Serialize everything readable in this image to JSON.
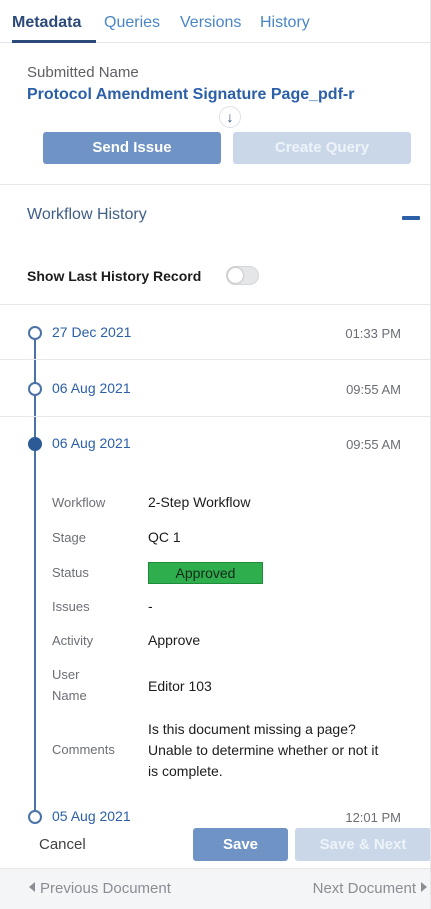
{
  "tabs": [
    "Metadata",
    "Queries",
    "Versions",
    "History"
  ],
  "submitted": {
    "label": "Submitted Name",
    "value": "Protocol Amendment Signature Page_pdf-r"
  },
  "actions": {
    "send_issue": "Send Issue",
    "create_query": "Create Query"
  },
  "workflow": {
    "title": "Workflow History",
    "toggle_label": "Show Last History Record",
    "toggle_on": false
  },
  "history": [
    {
      "date": "27 Dec 2021",
      "time": "01:33 PM"
    },
    {
      "date": "06 Aug 2021",
      "time": "09:55 AM"
    },
    {
      "date": "06 Aug 2021",
      "time": "09:55 AM"
    },
    {
      "date": "05 Aug 2021",
      "time": "12:01 PM"
    }
  ],
  "details": {
    "workflow_label": "Workflow",
    "workflow_value": "2-Step Workflow",
    "stage_label": "Stage",
    "stage_value": "QC 1",
    "status_label": "Status",
    "status_value": "Approved",
    "issues_label": "Issues",
    "issues_value": "-",
    "activity_label": "Activity",
    "activity_value": "Approve",
    "user_label_1": "User",
    "user_label_2": "Name",
    "user_value": "Editor 103",
    "comments_label": "Comments",
    "comments_line1": "Is this document missing a page?",
    "comments_line2": "Unable to determine whether or not it",
    "comments_line3": "is complete."
  },
  "footer": {
    "cancel": "Cancel",
    "save": "Save",
    "save_next": "Save & Next",
    "previous": "Previous Document",
    "next": "Next Document"
  },
  "colors": {
    "accent": "#2b5fa8",
    "button": "#6f93c4",
    "button_disabled": "#c9d7e8",
    "approved": "#2fae4e"
  }
}
